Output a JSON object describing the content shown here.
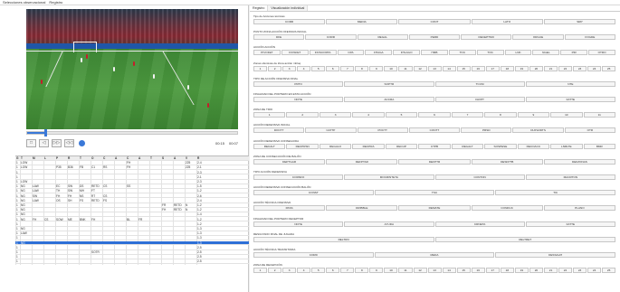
{
  "menubar": {
    "items": [
      "Selecciones observacional",
      "Registro"
    ]
  },
  "video": {
    "progress": 0.08
  },
  "controls": {
    "buttons": [
      "□",
      "◁",
      "▷▷",
      "◁◁"
    ],
    "time": [
      "00:15",
      "00:07"
    ]
  },
  "table": {
    "rows": [
      [
        "G",
        "T",
        "M",
        "L",
        "P",
        "R",
        "T",
        "O",
        "C",
        "A",
        "C",
        "A",
        "T",
        "S",
        "A",
        "V",
        "R"
      ],
      [
        "1",
        "LOW",
        "",
        "",
        "",
        "",
        "",
        "",
        "",
        "",
        "FH",
        "",
        "",
        "",
        "",
        "225",
        "2-4"
      ],
      [
        "1",
        "LOW",
        "",
        "",
        "P35",
        "B36",
        "FB",
        "C1",
        "RS",
        "",
        "FH",
        "",
        "",
        "",
        "",
        "225",
        "2-1"
      ],
      [
        "1",
        "",
        "",
        "",
        "",
        "",
        "",
        "",
        "",
        "",
        "",
        "",
        "",
        "",
        "",
        "",
        "2-3"
      ],
      [
        "1",
        "",
        "",
        "",
        "",
        "",
        "",
        "",
        "",
        "",
        "",
        "",
        "",
        "",
        "",
        "",
        "2-1"
      ],
      [
        "1",
        "LOW",
        "",
        "",
        "",
        "",
        "",
        "",
        "",
        "",
        "",
        "",
        "",
        "",
        "",
        "",
        "2-3"
      ],
      [
        "1",
        "NG",
        "LAW",
        "",
        "EC",
        "SW",
        "DS",
        "RETD",
        "CS",
        "",
        "SS",
        "",
        "",
        "",
        "",
        "",
        "1-5"
      ],
      [
        "1",
        "NG",
        "LAW",
        "",
        "TH",
        "SW",
        "MH",
        "FT",
        "",
        "",
        "",
        "",
        "",
        "",
        "",
        "",
        "1-2"
      ],
      [
        "1",
        "NG",
        "SW",
        "",
        "FH",
        "FH",
        "NS",
        "RT",
        "CS",
        "",
        "",
        "",
        "",
        "",
        "",
        "",
        "2-6"
      ],
      [
        "1",
        "NG",
        "LAW",
        "",
        "OS",
        "SH",
        "FS",
        "RETD",
        "FS",
        "",
        "",
        "",
        "",
        "",
        "",
        "",
        "2-4"
      ],
      [
        "1",
        "NG",
        "",
        "",
        "",
        "",
        "",
        "",
        "",
        "",
        "",
        "",
        "",
        "FR",
        "RETD",
        "N",
        "1-2"
      ],
      [
        "1",
        "NG",
        "",
        "",
        "",
        "",
        "",
        "",
        "",
        "",
        "",
        "",
        "",
        "FH",
        "RETD",
        "N",
        "1-2"
      ],
      [
        "1",
        "NG",
        "",
        "",
        "",
        "",
        "",
        "",
        "",
        "",
        "",
        "",
        "",
        "",
        "",
        "",
        "1-4"
      ],
      [
        "1",
        "NG",
        "FH",
        "CS",
        "SOW",
        "ME",
        "BNK",
        "FH",
        "",
        "",
        "BL",
        "FR",
        "",
        "",
        "",
        "",
        "1-2"
      ],
      [
        "1",
        "",
        "",
        "",
        "",
        "",
        "",
        "",
        "",
        "",
        "",
        "",
        "",
        "",
        "",
        "",
        "1-2"
      ],
      [
        "1",
        "NG",
        "",
        "",
        "",
        "",
        "",
        "",
        "",
        "",
        "",
        "",
        "",
        "",
        "",
        "",
        "1-3"
      ],
      [
        "1",
        "LAW",
        "",
        "",
        "",
        "",
        "",
        "",
        "",
        "",
        "",
        "",
        "",
        "",
        "",
        "",
        "1-3"
      ],
      [
        "1",
        "",
        "",
        "",
        "",
        "",
        "",
        "",
        "",
        "",
        "",
        "",
        "",
        "",
        "",
        "",
        "1-3"
      ],
      [
        "1",
        "NG",
        "",
        "",
        "",
        "",
        "",
        "",
        "",
        "",
        "",
        "",
        "",
        "",
        "",
        "",
        "1-3"
      ],
      [
        "1",
        "",
        "",
        "",
        "",
        "",
        "",
        "",
        "",
        "",
        "",
        "",
        "",
        "",
        "",
        "",
        "2-5"
      ],
      [
        "1",
        "",
        "",
        "",
        "",
        "",
        "",
        "SOTR",
        "",
        "",
        "",
        "",
        "",
        "",
        "",
        "",
        "2-5"
      ],
      [
        "1",
        "",
        "",
        "",
        "",
        "",
        "",
        "",
        "",
        "",
        "",
        "",
        "",
        "",
        "",
        "",
        "2-5"
      ],
      [
        "1",
        "",
        "",
        "",
        "",
        "",
        "",
        "",
        "",
        "",
        "",
        "",
        "",
        "",
        "",
        "",
        "2-5"
      ]
    ],
    "selected_row": 18
  },
  "right": {
    "tabs": [
      "Registro",
      "Visualización individual"
    ],
    "groups": [
      {
        "title": "Tipo de Acciones técnicas",
        "buttons": [
          "CORR",
          "MEDIA",
          "CONT",
          "LATO",
          "SRP"
        ]
      },
      {
        "title": "PUNTO ZONA ACCIÓN OFENSIVA INICIAL",
        "buttons": [
          "DFE",
          "CORR",
          "REGAL",
          "PERD",
          "RECEPTMO",
          "ORGUE",
          "FOGDE"
        ]
      },
      {
        "title": "ACCIÓN ACCIÓN",
        "buttons": [
          "PIVOFET",
          "FIOSFET",
          "FIOSCORTA",
          "CPA",
          "FHAGA",
          "FHLAGO",
          "HMB",
          "TOC",
          "TOC",
          "LNK",
          "NGEL",
          "PIR",
          "OTRO"
        ]
      },
      {
        "title": "Zonas ofensivas de Zona acción mbloq",
        "buttons": [
          "1",
          "2",
          "3",
          "4",
          "5",
          "6",
          "7",
          "8",
          "9",
          "10",
          "11",
          "12",
          "13",
          "14",
          "15",
          "16",
          "17",
          "18",
          "19",
          "20",
          "21",
          "22",
          "23",
          "24",
          "25"
        ]
      },
      {
        "title": "TIPO DE ACCIÓN OFENSIVA FINAL",
        "buttons": [
          "PRTO",
          "SOPTR",
          "TCCM",
          "NTE"
        ]
      },
      {
        "title": "FINALIDAD DEL PORTERO EN ESTA ACCIÓN",
        "buttons": [
          "NOTE",
          "ACCRA",
          "FAVPT",
          "FATTE"
        ]
      },
      {
        "title": "ZONA DE TIRO",
        "buttons": [
          "1",
          "2",
          "3",
          "4",
          "5",
          "6",
          "7",
          "8",
          "9",
          "10",
          "11"
        ]
      },
      {
        "title": "ACCIÓN DEFENSIVA INICIAL",
        "buttons": [
          "DOCTT",
          "CATTP",
          "POCTT",
          "CONTT",
          "PRSD",
          "DUPLRDTS",
          "OTR"
        ]
      },
      {
        "title": "ACCIÓN DEFENSIVA CONSEGUIDA",
        "buttons": [
          "RECALT",
          "RECPRSN",
          "REGALO",
          "RECPRA",
          "RECUP",
          "CTPB",
          "REGALT",
          "SOSPESE",
          "RECOACC",
          "LNRLTE",
          "BMR"
        ]
      },
      {
        "title": "ZONA DE CONSECUCIÓN DE BALÓN",
        "buttons": [
          "DEPTGAR",
          "DEFPTAR",
          "DEFPTR",
          "DESFPTB",
          "DEFZONAS"
        ]
      },
      {
        "title": "TIPO ACCIÓN DEFENSIVA",
        "buttons": [
          "CORNFO",
          "MOCRINTETA",
          "CONTON",
          "MACRTON"
        ]
      },
      {
        "title": "ACCIÓN DEFENSIVA CONSECUCIÓN BALÓN",
        "buttons": [
          "CONST",
          "TSC",
          "TIC"
        ]
      },
      {
        "title": "ACCIÓN TÉCNICA OFENSIVA",
        "buttons": [
          "PASS",
          "DRIBBLE",
          "REMATE",
          "CONDUC",
          "PLANO"
        ]
      },
      {
        "title": "FINALIDAD DEL PORTERO RECEPTOR",
        "buttons": [
          "NOTE",
          "AYUDA",
          "CRNETA",
          "FATTE"
        ]
      },
      {
        "title": "RESULTADO FINAL DE JUGADA",
        "buttons": [
          "RELTRO",
          "RELTRET"
        ]
      },
      {
        "title": "ACCIÓN TÉCNICA TRANSITORIA",
        "buttons": [
          "CORD",
          "MEDA",
          "DESSALPI"
        ]
      },
      {
        "title": "ZONA DE RECEPCIÓN",
        "buttons": [
          "1",
          "2",
          "3",
          "4",
          "5",
          "6",
          "7",
          "8",
          "9",
          "10",
          "11",
          "12",
          "13",
          "14",
          "15",
          "16",
          "17",
          "18",
          "19",
          "20",
          "21",
          "22",
          "23",
          "24",
          "25"
        ]
      }
    ]
  }
}
